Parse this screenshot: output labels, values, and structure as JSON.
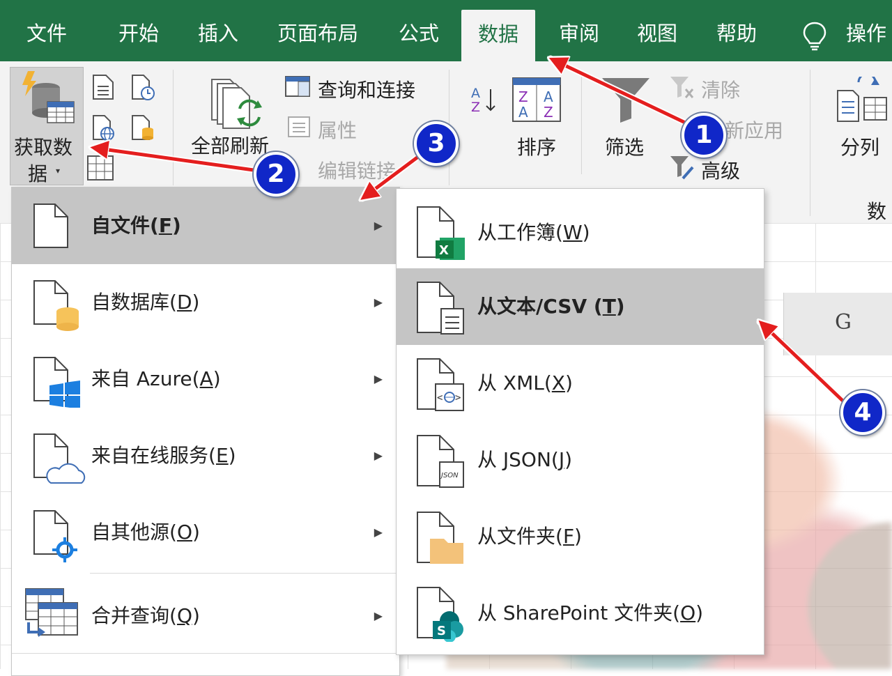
{
  "tabs": [
    "文件",
    "开始",
    "插入",
    "页面布局",
    "公式",
    "数据",
    "审阅",
    "视图",
    "帮助",
    "操作"
  ],
  "active_tab": "数据",
  "ribbon": {
    "get_data": [
      "获取数",
      "据"
    ],
    "refresh_all": "全部刷新",
    "queries_connections": "查询和连接",
    "properties": "属性",
    "edit_links": "编辑链接",
    "sort": "排序",
    "filter": "筛选",
    "clear": "清除",
    "reapply": "新应用",
    "advanced": "高级",
    "text_to_columns": "分列",
    "data_tools_group": "数"
  },
  "column_header": "G",
  "menu_main": [
    {
      "text": "自文件(",
      "key": "F",
      "end": ")",
      "icon": "file-icon",
      "highlighted": true
    },
    {
      "text": "自数据库(",
      "key": "D",
      "end": ")",
      "icon": "database-file-icon",
      "highlighted": false
    },
    {
      "text": "来自 Azure(",
      "key": "A",
      "end": ")",
      "icon": "azure-file-icon",
      "highlighted": false
    },
    {
      "text": "来自在线服务(",
      "key": "E",
      "end": ")",
      "icon": "cloud-file-icon",
      "highlighted": false
    },
    {
      "text": "自其他源(",
      "key": "O",
      "end": ")",
      "icon": "other-source-file-icon",
      "highlighted": false
    },
    {
      "text": "合并查询(",
      "key": "Q",
      "end": ")",
      "icon": "combine-queries-icon",
      "highlighted": false
    }
  ],
  "menu_sub": [
    {
      "text": "从工作簿(",
      "key": "W",
      "end": ")",
      "icon": "excel-file-icon",
      "highlighted": false
    },
    {
      "text": "从文本/CSV (",
      "key": "T",
      "end": ")",
      "icon": "text-csv-file-icon",
      "highlighted": true
    },
    {
      "text": "从 XML(",
      "key": "X",
      "end": ")",
      "icon": "xml-file-icon",
      "highlighted": false
    },
    {
      "text": "从 JSON(",
      "key": "J",
      "end": ")",
      "icon": "json-file-icon",
      "highlighted": false
    },
    {
      "text": "从文件夹(",
      "key": "F",
      "end": ")",
      "icon": "folder-file-icon",
      "highlighted": false
    },
    {
      "text": "从 SharePoint 文件夹(",
      "key": "O",
      "end": ")",
      "icon": "sharepoint-file-icon",
      "highlighted": false
    }
  ],
  "callouts": [
    "1",
    "2",
    "3",
    "4"
  ],
  "colors": {
    "excel_green": "#217346",
    "callout_blue": "#1027c8",
    "arrow_red": "#e41e1e"
  }
}
